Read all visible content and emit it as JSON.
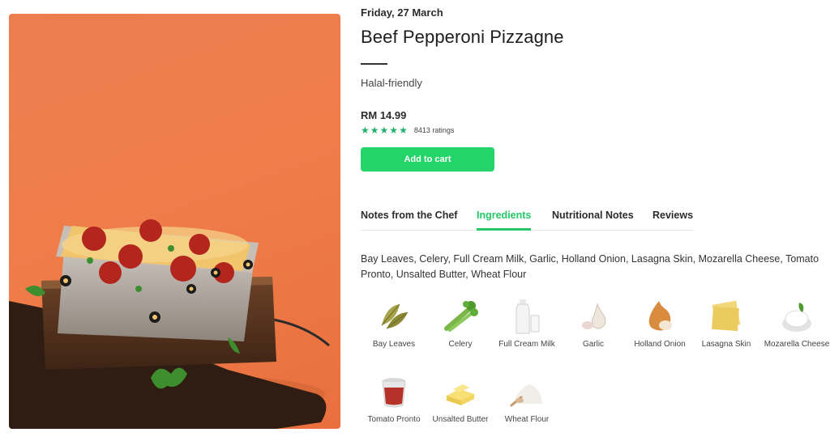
{
  "date": "Friday, 27 March",
  "title": "Beef Pepperoni Pizzagne",
  "subtitle": "Halal-friendly",
  "price": "RM 14.99",
  "rating": {
    "stars": 5,
    "max": 5,
    "count_text": "8413 ratings"
  },
  "add_to_cart": "Add to cart",
  "tabs": [
    {
      "label": "Notes from the Chef",
      "active": false
    },
    {
      "label": "Ingredients",
      "active": true
    },
    {
      "label": "Nutritional Notes",
      "active": false
    },
    {
      "label": "Reviews",
      "active": false
    }
  ],
  "ingredients_text": "Bay Leaves, Celery, Full Cream Milk, Garlic, Holland Onion, Lasagna Skin, Mozarella Cheese, Tomato Pronto, Unsalted Butter, Wheat Flour",
  "ingredients": [
    {
      "label": "Bay Leaves",
      "icon": "bay-leaves-icon"
    },
    {
      "label": "Celery",
      "icon": "celery-icon"
    },
    {
      "label": "Full Cream Milk",
      "icon": "milk-icon"
    },
    {
      "label": "Garlic",
      "icon": "garlic-icon"
    },
    {
      "label": "Holland Onion",
      "icon": "onion-icon"
    },
    {
      "label": "Lasagna Skin",
      "icon": "lasagna-skin-icon"
    },
    {
      "label": "Mozarella Cheese",
      "icon": "mozarella-icon"
    },
    {
      "label": "Tomato Pronto",
      "icon": "tomato-sauce-icon"
    },
    {
      "label": "Unsalted Butter",
      "icon": "butter-icon"
    },
    {
      "label": "Wheat Flour",
      "icon": "flour-icon"
    }
  ],
  "colors": {
    "accent": "#23c866",
    "button": "#25d468",
    "hero_bg": "#ef7d4a"
  }
}
